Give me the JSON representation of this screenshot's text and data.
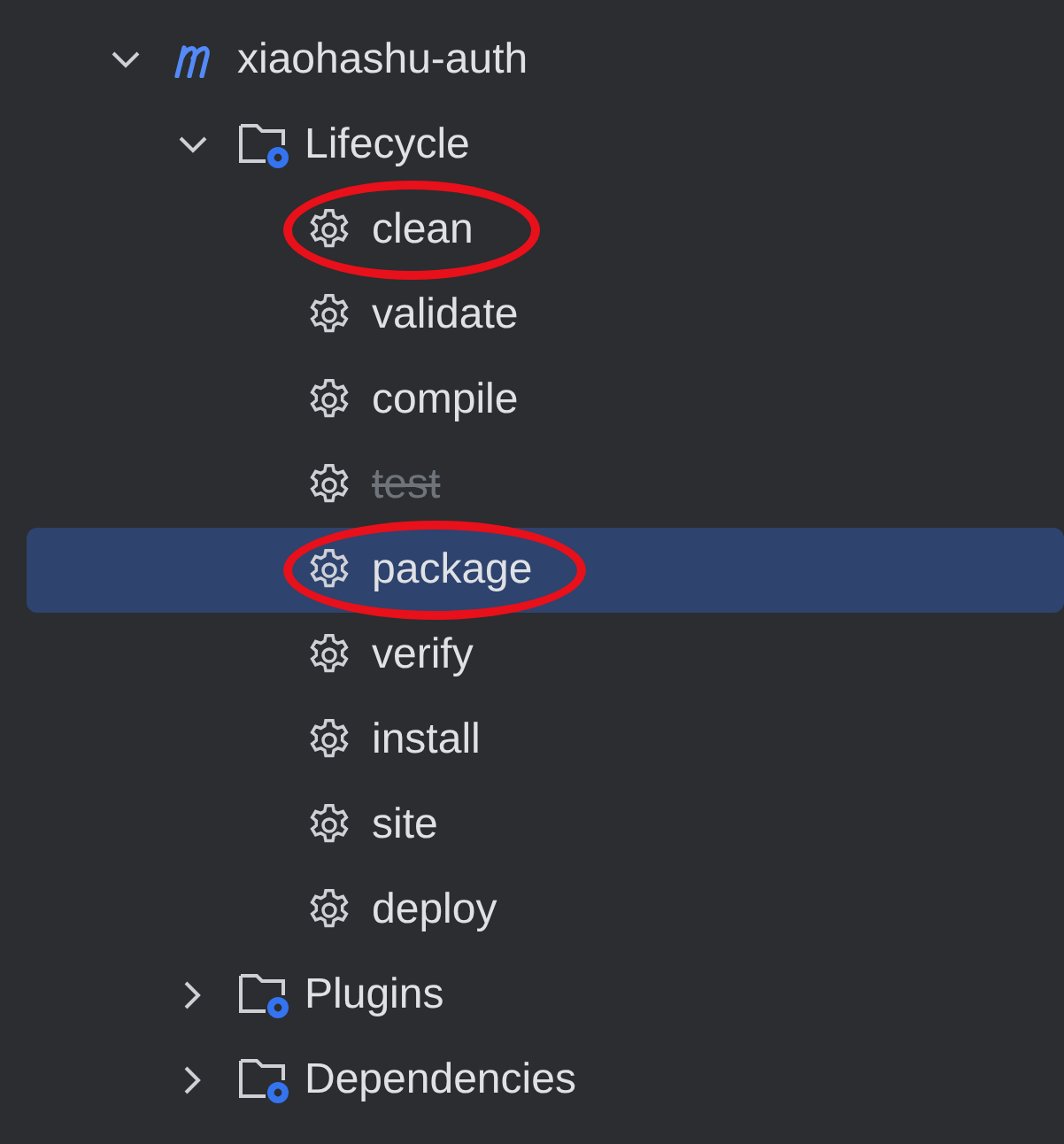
{
  "tree": [
    {
      "kind": "module",
      "label": "xiaohashu-auth",
      "expanded": true,
      "selected": false,
      "children": [
        {
          "kind": "folder",
          "label": "Lifecycle",
          "expanded": true,
          "selected": false,
          "children": [
            {
              "kind": "goal",
              "label": "clean",
              "selected": false,
              "disabled": false,
              "circled": true
            },
            {
              "kind": "goal",
              "label": "validate",
              "selected": false,
              "disabled": false,
              "circled": false
            },
            {
              "kind": "goal",
              "label": "compile",
              "selected": false,
              "disabled": false,
              "circled": false
            },
            {
              "kind": "goal",
              "label": "test",
              "selected": false,
              "disabled": true,
              "circled": false
            },
            {
              "kind": "goal",
              "label": "package",
              "selected": true,
              "disabled": false,
              "circled": true
            },
            {
              "kind": "goal",
              "label": "verify",
              "selected": false,
              "disabled": false,
              "circled": false
            },
            {
              "kind": "goal",
              "label": "install",
              "selected": false,
              "disabled": false,
              "circled": false
            },
            {
              "kind": "goal",
              "label": "site",
              "selected": false,
              "disabled": false,
              "circled": false
            },
            {
              "kind": "goal",
              "label": "deploy",
              "selected": false,
              "disabled": false,
              "circled": false
            }
          ]
        },
        {
          "kind": "folder",
          "label": "Plugins",
          "expanded": false,
          "selected": false
        },
        {
          "kind": "folder",
          "label": "Dependencies",
          "expanded": false,
          "selected": false
        }
      ]
    }
  ]
}
